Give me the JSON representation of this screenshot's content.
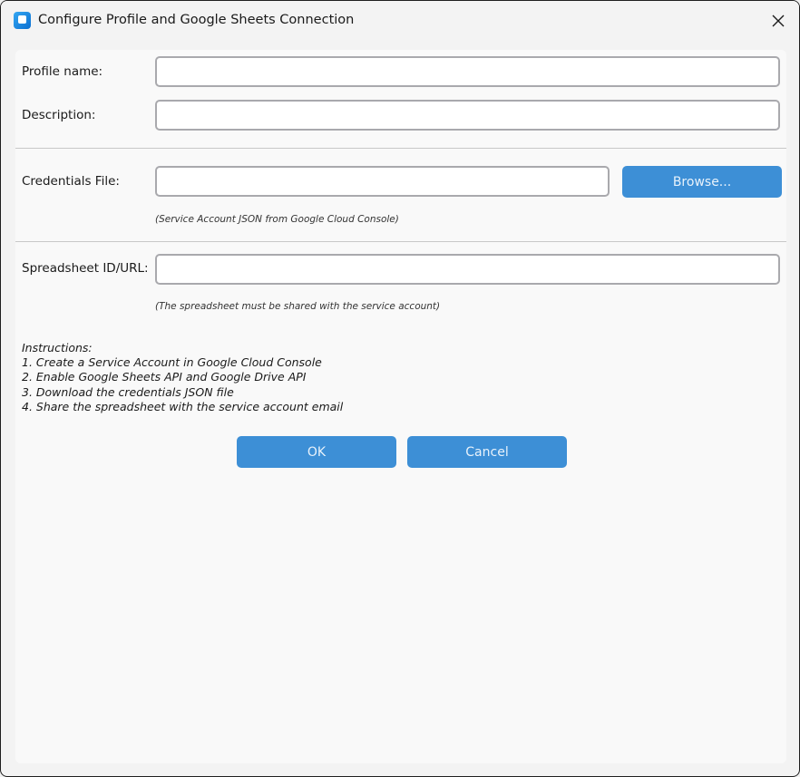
{
  "window": {
    "title": "Configure Profile and Google Sheets Connection"
  },
  "icons": {
    "app": "app-icon",
    "close": "close-icon"
  },
  "form": {
    "profile_name_label": "Profile name:",
    "profile_name_value": "",
    "description_label": "Description:",
    "description_value": "",
    "credentials_label": "Credentials File:",
    "credentials_value": "",
    "browse_label": "Browse...",
    "credentials_hint": "(Service Account JSON from Google Cloud Console)",
    "spreadsheet_label": "Spreadsheet ID/URL:",
    "spreadsheet_value": "",
    "spreadsheet_hint": "(The spreadsheet must be shared with the service account)"
  },
  "instructions": {
    "heading": "Instructions:",
    "steps": [
      "1. Create a Service Account in Google Cloud Console",
      "2. Enable Google Sheets API and Google Drive API",
      "3. Download the credentials JSON file",
      "4. Share the spreadsheet with the service account email"
    ]
  },
  "buttons": {
    "ok_label": "OK",
    "cancel_label": "Cancel"
  },
  "colors": {
    "accent": "#3d8fd6",
    "button_text": "#e8f2fb",
    "field_border": "#a9a9ad"
  }
}
